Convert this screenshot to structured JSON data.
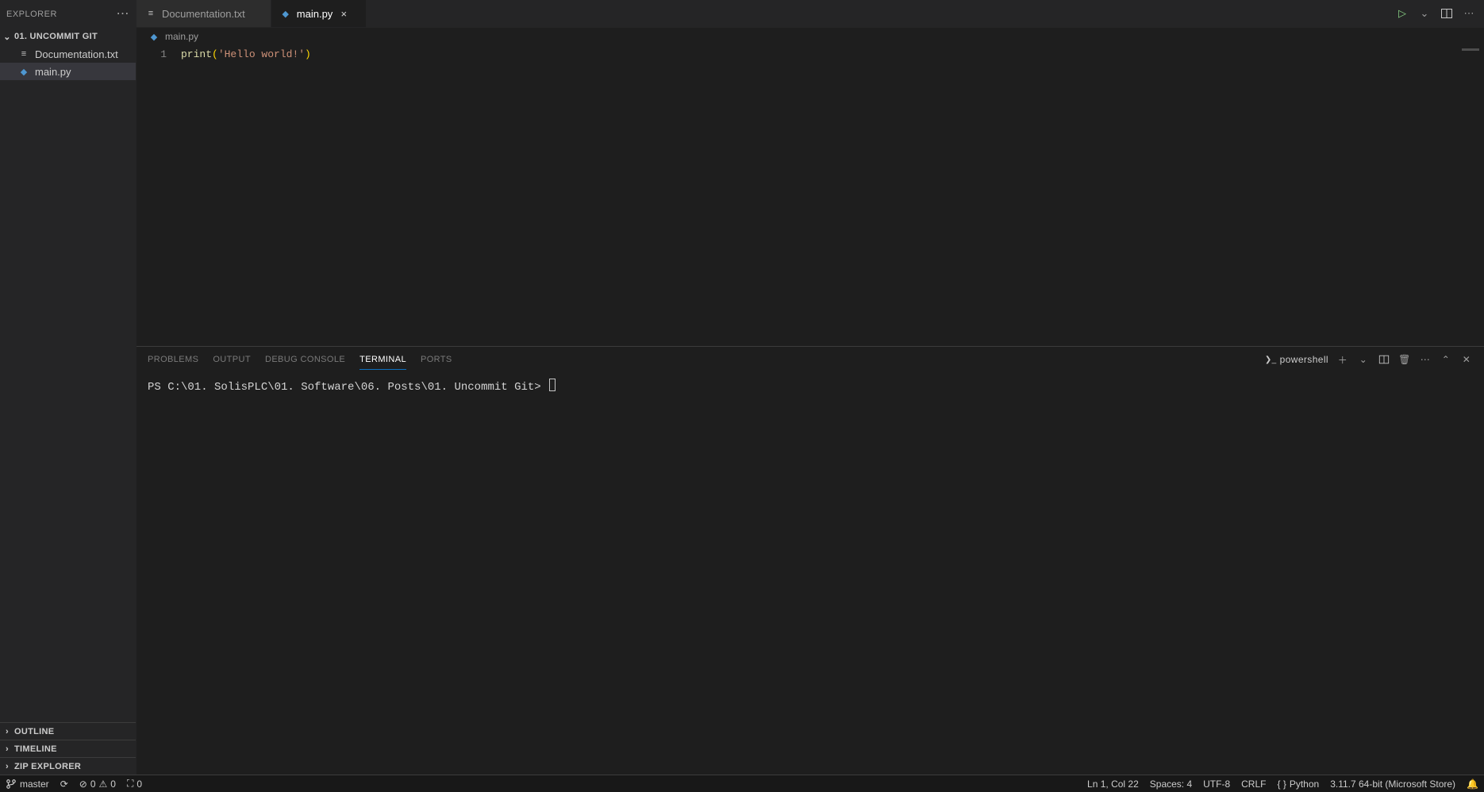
{
  "sidebar": {
    "title": "EXPLORER",
    "folder_header": "01. UNCOMMIT GIT",
    "files": [
      {
        "name": "Documentation.txt",
        "icon": "txt",
        "selected": false
      },
      {
        "name": "main.py",
        "icon": "py",
        "selected": true
      }
    ],
    "collapsed_sections": [
      "OUTLINE",
      "TIMELINE",
      "ZIP EXPLORER"
    ]
  },
  "tabs": [
    {
      "label": "Documentation.txt",
      "icon": "txt",
      "active": false
    },
    {
      "label": "main.py",
      "icon": "py",
      "active": true
    }
  ],
  "breadcrumb": {
    "icon": "py",
    "label": "main.py"
  },
  "editor": {
    "line_number": "1",
    "code_tokens": {
      "fn": "print",
      "open": "(",
      "str": "'Hello world!'",
      "close": ")"
    }
  },
  "panel": {
    "tabs": [
      "PROBLEMS",
      "OUTPUT",
      "DEBUG CONSOLE",
      "TERMINAL",
      "PORTS"
    ],
    "active_tab": "TERMINAL",
    "terminal_profile": "powershell",
    "terminal_prompt": "PS C:\\01. SolisPLC\\01. Software\\06. Posts\\01. Uncommit Git> "
  },
  "statusbar": {
    "branch": "master",
    "errors": "0",
    "warnings": "0",
    "ports": "0",
    "cursor": "Ln 1, Col 22",
    "spaces": "Spaces: 4",
    "encoding": "UTF-8",
    "eol": "CRLF",
    "language_icon_label": "{ }",
    "language": "Python",
    "interpreter": "3.11.7 64-bit (Microsoft Store)"
  },
  "icons": {
    "run": "▷",
    "chev_down_small": "⌄",
    "split": "▯▯",
    "more": "⋯",
    "close": "×",
    "chev_right": "›",
    "chev_down": "⌄",
    "chev_collapsed": "›",
    "plus": "＋",
    "trash": "🗑",
    "maximize": "⌃",
    "panel_close": "✕",
    "branch": "⎇",
    "sync": "⟳",
    "error": "⊘",
    "warn": "⚠",
    "radio": "⛶",
    "bell": "🔔",
    "term": "❯_",
    "file_txt": "≡",
    "file_py": "◆"
  }
}
